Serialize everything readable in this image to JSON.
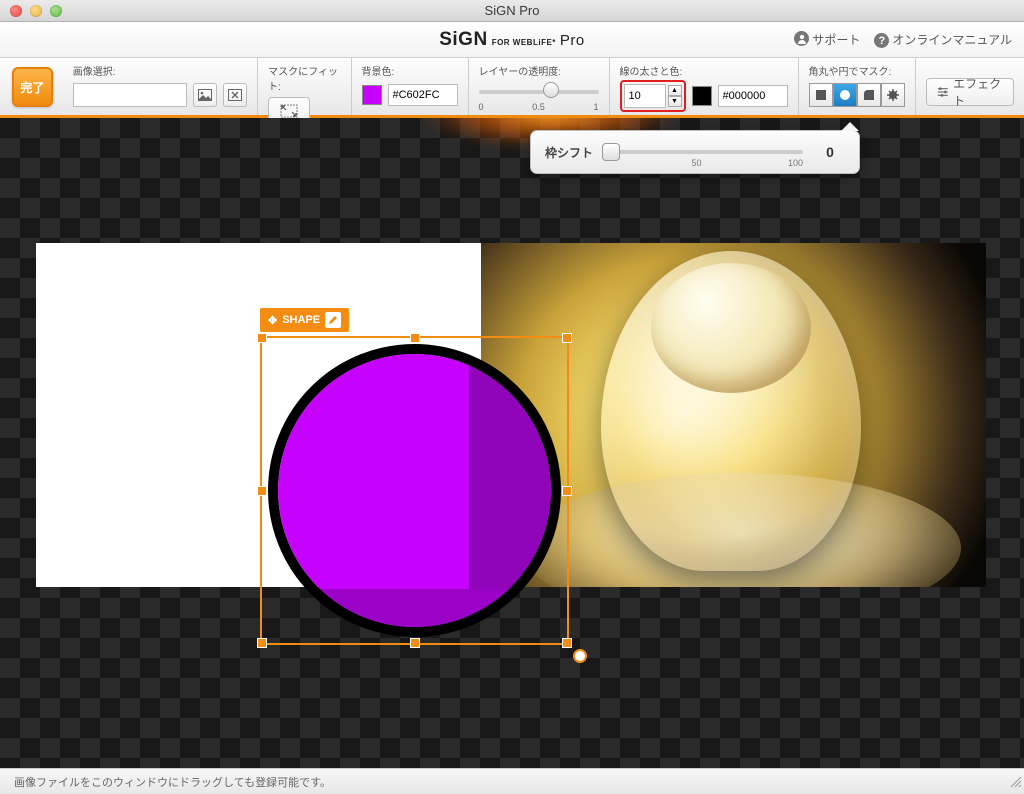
{
  "window": {
    "title": "SiGN Pro"
  },
  "brand": {
    "name": "SiGN",
    "sub": "FOR WEBLiFE*",
    "tier": "Pro"
  },
  "header_links": {
    "support": "サポート",
    "manual": "オンラインマニュアル"
  },
  "toolbar": {
    "done": "完了",
    "image_select": {
      "label": "画像選択:"
    },
    "mask_fit": {
      "label": "マスクにフィット:"
    },
    "bg_color": {
      "label": "背景色:",
      "hex": "#C602FC"
    },
    "opacity": {
      "label": "レイヤーの透明度:",
      "min": "0",
      "mid": "0.5",
      "max": "1"
    },
    "stroke": {
      "label": "線の太さと色:",
      "thickness": "10",
      "hex": "#000000"
    },
    "mask_shape": {
      "label": "角丸や円でマスク:"
    },
    "effect": "エフェクト"
  },
  "shift": {
    "label": "枠シフト",
    "mid": "50",
    "max": "100",
    "value": "0"
  },
  "shape": {
    "tag": "SHAPE"
  },
  "footer": {
    "hint": "画像ファイルをこのウィンドウにドラッグしても登録可能です。"
  }
}
